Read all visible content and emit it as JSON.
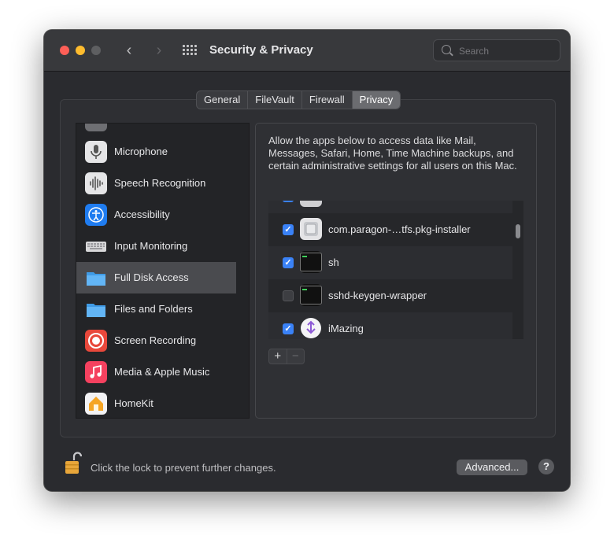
{
  "window": {
    "title": "Security & Privacy"
  },
  "search": {
    "placeholder": "Search"
  },
  "tabs": [
    {
      "label": "General"
    },
    {
      "label": "FileVault"
    },
    {
      "label": "Firewall"
    },
    {
      "label": "Privacy",
      "selected": true
    }
  ],
  "sidebar": {
    "items": [
      {
        "label": "Microphone",
        "icon": "microphone-icon"
      },
      {
        "label": "Speech Recognition",
        "icon": "speech-recognition-icon"
      },
      {
        "label": "Accessibility",
        "icon": "accessibility-icon"
      },
      {
        "label": "Input Monitoring",
        "icon": "keyboard-icon"
      },
      {
        "label": "Full Disk Access",
        "icon": "folder-icon",
        "selected": true
      },
      {
        "label": "Files and Folders",
        "icon": "folder-icon"
      },
      {
        "label": "Screen Recording",
        "icon": "screen-recording-icon"
      },
      {
        "label": "Media & Apple Music",
        "icon": "music-icon"
      },
      {
        "label": "HomeKit",
        "icon": "homekit-icon"
      }
    ]
  },
  "main": {
    "description": "Allow the apps below to access data like Mail, Messages, Safari, Home, Time Machine backups, and certain administrative settings for all users on this Mac.",
    "apps": [
      {
        "name": "com.paragon-…tfs.pkg-installer",
        "checked": true,
        "icon": "package-installer-icon"
      },
      {
        "name": "sh",
        "checked": true,
        "icon": "terminal-icon"
      },
      {
        "name": "sshd-keygen-wrapper",
        "checked": false,
        "icon": "terminal-icon"
      },
      {
        "name": "iMazing",
        "checked": true,
        "icon": "imazing-icon"
      }
    ],
    "add_label": "+",
    "remove_label": "−"
  },
  "footer": {
    "lock_text": "Click the lock to prevent further changes.",
    "advanced_label": "Advanced...",
    "help_label": "?"
  },
  "colors": {
    "accent": "#3a82f7",
    "window_bg": "#2a2b2f"
  }
}
